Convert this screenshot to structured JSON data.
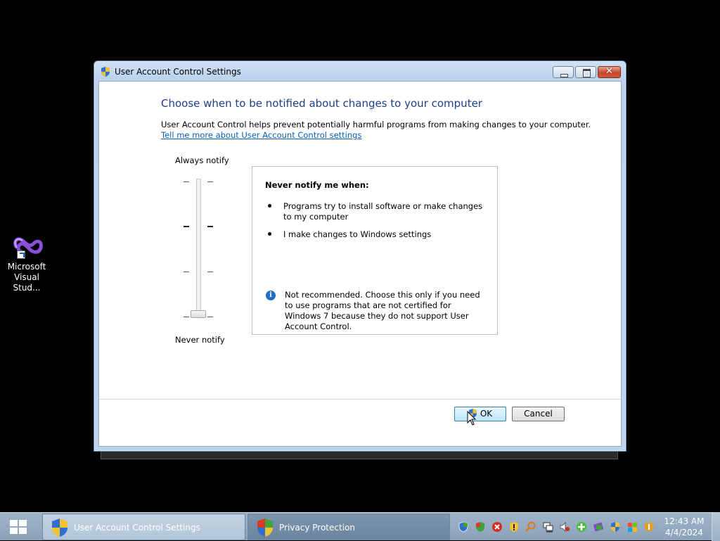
{
  "desktop": {
    "icons": [
      {
        "label_line1": "Microsoft",
        "label_line2": "Visual Stud...",
        "icon": "visual-studio-icon"
      }
    ]
  },
  "window": {
    "title": "User Account Control Settings",
    "heading": "Choose when to be notified about changes to your computer",
    "description": "User Account Control helps prevent potentially harmful programs from making changes to your computer.",
    "learn_more_link": "Tell me more about User Account Control settings",
    "slider": {
      "top_label": "Always notify",
      "bottom_label": "Never notify",
      "levels": 4,
      "selected_level": 1
    },
    "info": {
      "title": "Never notify me when:",
      "bullets": [
        "Programs try to install software or make changes to my computer",
        "I make changes to Windows settings"
      ],
      "note": "Not recommended. Choose this only if you need to use programs that are not certified for Windows 7 because they do not support User Account Control."
    },
    "buttons": {
      "ok": "OK",
      "cancel": "Cancel"
    },
    "titlebar": {
      "close_glyph": "✕"
    }
  },
  "taskbar": {
    "tasks": [
      {
        "label": "User Account Control Settings",
        "icon": "uac-shield-icon",
        "active": true
      },
      {
        "label": "Privacy Protection",
        "icon": "security-shield-icon",
        "active": false
      }
    ],
    "tray_icons": [
      "shield-icon",
      "security-shield-icon",
      "error-icon",
      "warning-shield-icon",
      "search-icon",
      "network-icon",
      "volume-icon",
      "add-icon",
      "app-icon",
      "uac-shield-icon",
      "flag-icon",
      "security-icon"
    ],
    "clock": {
      "time": "12:43 AM",
      "date": "4/4/2024"
    }
  },
  "colors": {
    "heading": "#1e3f8a",
    "link": "#0b5fb3",
    "taskbar": "#8aa2ba",
    "desktop": "#000000"
  }
}
